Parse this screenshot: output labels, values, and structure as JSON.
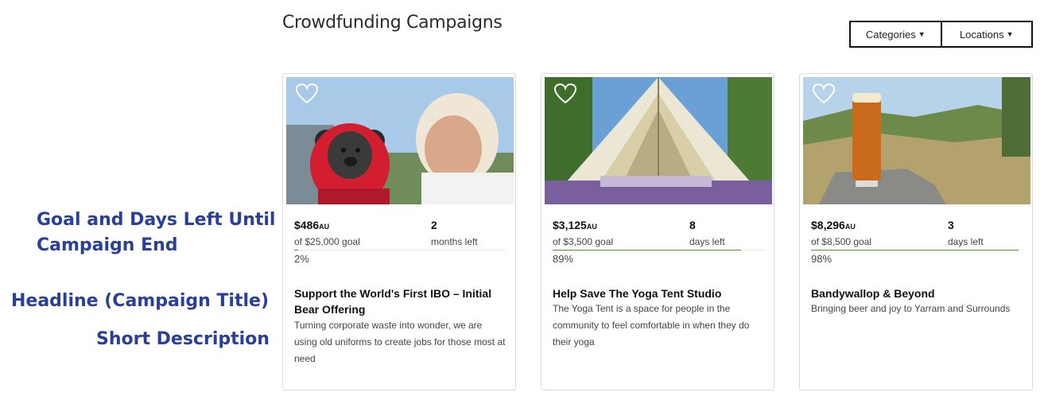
{
  "page": {
    "title": "Crowdfunding Campaigns"
  },
  "filters": {
    "categories": "Categories",
    "locations": "Locations"
  },
  "annotations": {
    "goal_line1": "Goal and Days Left Until",
    "goal_line2": "Campaign End",
    "headline": "Headline (Campaign Title)",
    "short_description": "Short Description"
  },
  "campaigns": [
    {
      "raised": "$486",
      "currency": "AU",
      "goal": "of $25,000 goal",
      "time_value": "2",
      "time_unit": "months left",
      "percent_label": "2%",
      "progress": 0.02,
      "title": "Support the World's First IBO – Initial Bear Offering",
      "description": "Turning corporate waste into wonder, we are using old uniforms to create jobs for those most at need",
      "image_icon": "teddy-bear-photo"
    },
    {
      "raised": "$3,125",
      "currency": "AU",
      "goal": "of $3,500 goal",
      "time_value": "8",
      "time_unit": "days left",
      "percent_label": "89%",
      "progress": 0.89,
      "title": "Help Save The Yoga Tent Studio",
      "description": "The Yoga Tent is a space for people in the community to feel comfortable in when they do their yoga",
      "image_icon": "yoga-tent-photo"
    },
    {
      "raised": "$8,296",
      "currency": "AU",
      "goal": "of $8,500 goal",
      "time_value": "3",
      "time_unit": "days left",
      "percent_label": "98%",
      "progress": 0.98,
      "title": "Bandywallop & Beyond",
      "description": "Bringing beer and joy to Yarram and Surrounds",
      "image_icon": "beer-glass-photo"
    }
  ],
  "colors": {
    "annotation": "#2a3f98",
    "progress": "#4c9a2a"
  }
}
